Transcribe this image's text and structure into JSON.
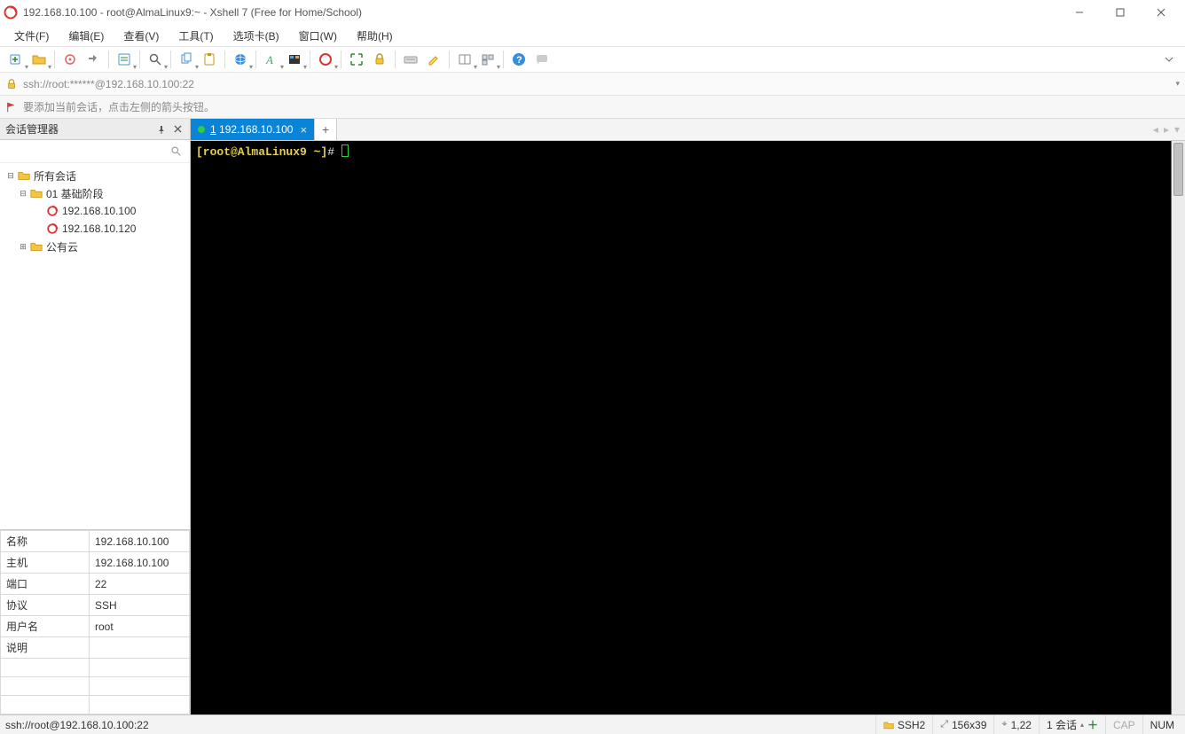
{
  "title_bar": {
    "title": "192.168.10.100 - root@AlmaLinux9:~ - Xshell 7 (Free for Home/School)"
  },
  "menu": {
    "file": "文件(F)",
    "edit": "编辑(E)",
    "view": "查看(V)",
    "tools": "工具(T)",
    "tabs": "选项卡(B)",
    "window": "窗口(W)",
    "help": "帮助(H)"
  },
  "addr": {
    "text": "ssh://root:******@192.168.10.100:22"
  },
  "hint": {
    "text": "要添加当前会话，点击左侧的箭头按钮。"
  },
  "sidebar": {
    "title": "会话管理器",
    "search_placeholder": "",
    "tree": {
      "root": "所有会话",
      "folder1": "01 基础阶段",
      "host1": "192.168.10.100",
      "host2": "192.168.10.120",
      "folder2": "公有云"
    },
    "props": [
      {
        "k": "名称",
        "v": "192.168.10.100"
      },
      {
        "k": "主机",
        "v": "192.168.10.100"
      },
      {
        "k": "端口",
        "v": "22"
      },
      {
        "k": "协议",
        "v": "SSH"
      },
      {
        "k": "用户名",
        "v": "root"
      },
      {
        "k": "说明",
        "v": ""
      }
    ]
  },
  "tabs": {
    "active_label": "1 192.168.10.100"
  },
  "terminal": {
    "prompt_user_host": "[root@AlmaLinux9 ~]",
    "prompt_symbol": "#"
  },
  "status": {
    "left": "ssh://root@192.168.10.100:22",
    "proto": "SSH2",
    "size": "156x39",
    "cursor": "1,22",
    "sessions": "1 会话",
    "cap": "CAP",
    "num": "NUM"
  },
  "icons": {
    "swirl": "swirl"
  }
}
